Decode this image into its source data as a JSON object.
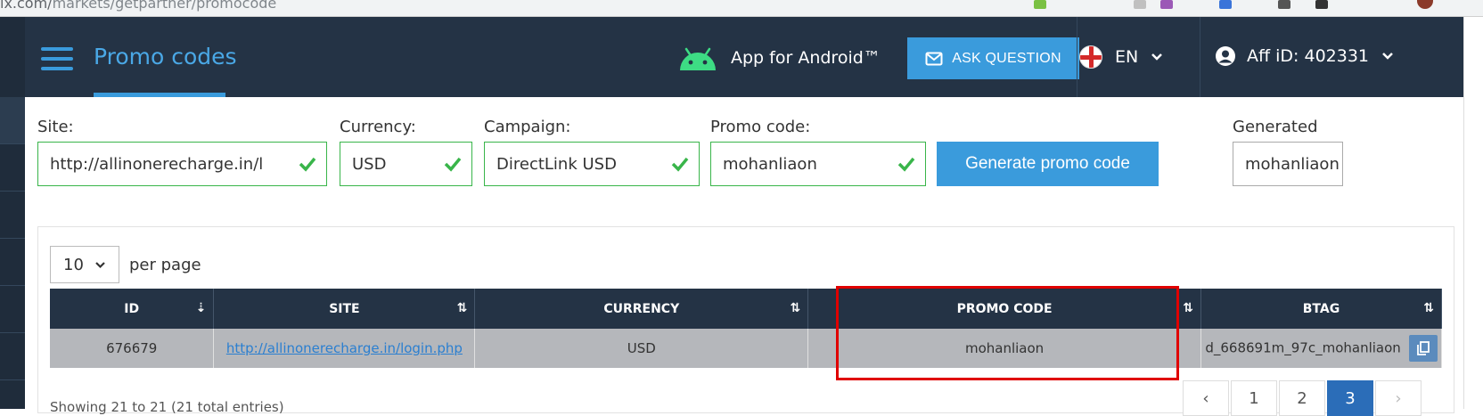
{
  "browser": {
    "url_prefix": "ix.com/",
    "url_path": "markets/getpartner/promocode"
  },
  "header": {
    "title": "Promo codes",
    "android_label": "App for Android™",
    "ask_question_label": "ASK QUESTION",
    "language": "EN",
    "aff_id": "Aff iD: 402331"
  },
  "form": {
    "site_label": "Site:",
    "site_value": "http://allinonerecharge.in/l",
    "currency_label": "Currency:",
    "currency_value": "USD",
    "campaign_label": "Campaign:",
    "campaign_value": "DirectLink USD",
    "promo_label": "Promo code:",
    "promo_value": "mohanliaon",
    "generate_label": "Generate promo code",
    "generated_label": "Generated",
    "generated_value": "mohanliaon"
  },
  "table": {
    "per_page_value": "10",
    "per_page_label": "per page",
    "headers": {
      "id": "ID",
      "site": "SITE",
      "currency": "CURRENCY",
      "promo": "PROMO CODE",
      "btag": "BTAG"
    },
    "rows": [
      {
        "id": "676679",
        "site": "http://allinonerecharge.in/login.php",
        "currency": "USD",
        "promo": "mohanliaon",
        "btag": "d_668691m_97c_mohanliaon"
      }
    ],
    "showing": "Showing 21 to 21 (21 total entries)"
  },
  "pagination": {
    "prev": "‹",
    "pages": [
      "1",
      "2",
      "3"
    ],
    "active": "3",
    "next": "›"
  },
  "colors": {
    "header_bg": "#243345",
    "accent": "#3a9bdc",
    "valid_border": "#39b54a",
    "highlight": "#e00000"
  }
}
